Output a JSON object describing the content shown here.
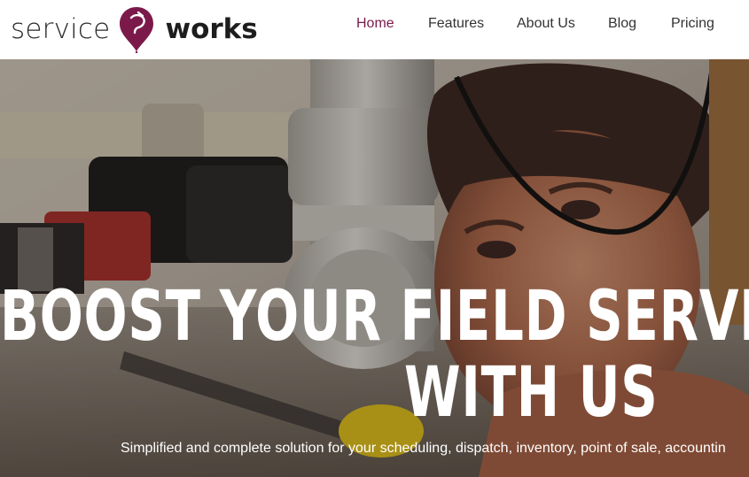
{
  "brand": {
    "name_left": "service",
    "name_right": "works",
    "accent_color": "#7b1a4a"
  },
  "nav": {
    "items": [
      {
        "label": "Home",
        "active": true
      },
      {
        "label": "Features",
        "active": false
      },
      {
        "label": "About Us",
        "active": false
      },
      {
        "label": "Blog",
        "active": false
      },
      {
        "label": "Pricing",
        "active": false
      }
    ]
  },
  "hero": {
    "title_line1": "BOOST YOUR FIELD SERVICE O",
    "title_line2": "WITH US",
    "subtitle": "Simplified and complete solution for your scheduling, dispatch, inventory, point of sale, accountin",
    "background": "plumber-photo"
  }
}
